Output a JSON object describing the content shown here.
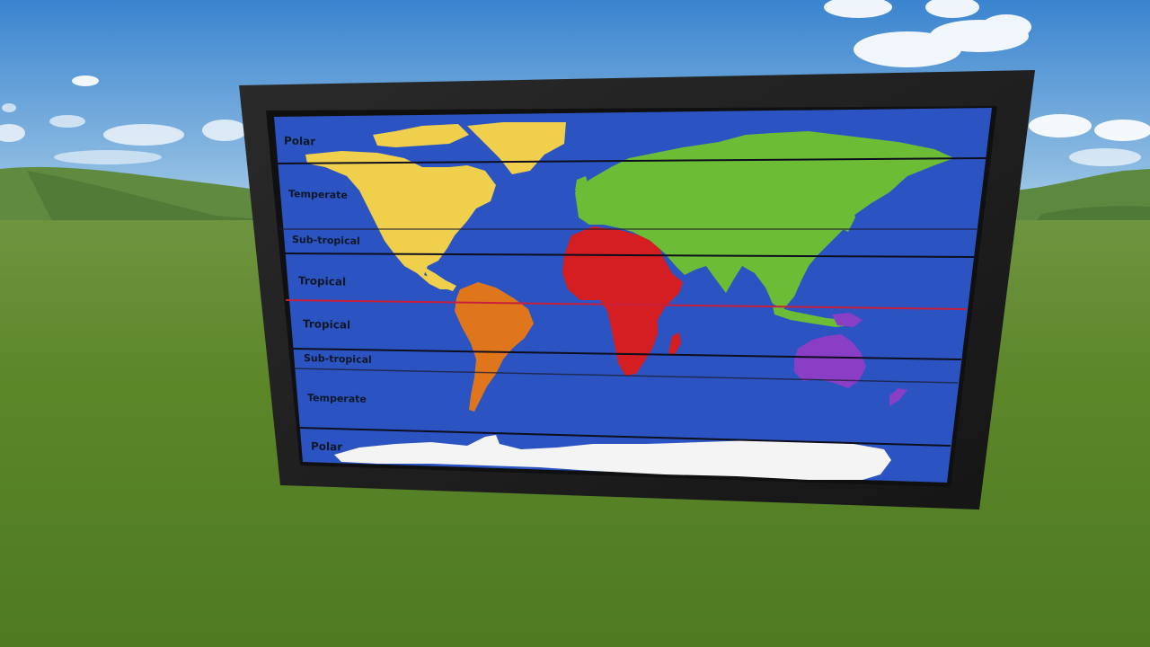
{
  "scene": {
    "description_type": "3d-world-map-billboard",
    "colors": {
      "sky_top": "#3d86cf",
      "sky_bottom": "#a9cce6",
      "grass": "#5d8a2a",
      "frame": "#1e1e1e",
      "ocean": "#2b54c2",
      "equator": "#c8203a",
      "north_america": "#f0cf4c",
      "south_america": "#e0761c",
      "africa": "#d41e22",
      "eurasia": "#6cbd35",
      "australia": "#8a3ec6",
      "antarctica": "#f4f4f4"
    }
  },
  "map": {
    "zones": [
      {
        "id": "polar-north",
        "label": "Polar"
      },
      {
        "id": "temperate-north",
        "label": "Temperate"
      },
      {
        "id": "subtropical-north",
        "label": "Sub-tropical"
      },
      {
        "id": "tropical-north",
        "label": "Tropical"
      },
      {
        "id": "tropical-south",
        "label": "Tropical"
      },
      {
        "id": "subtropical-south",
        "label": "Sub-tropical"
      },
      {
        "id": "temperate-south",
        "label": "Temperate"
      },
      {
        "id": "polar-south",
        "label": "Polar"
      }
    ]
  }
}
